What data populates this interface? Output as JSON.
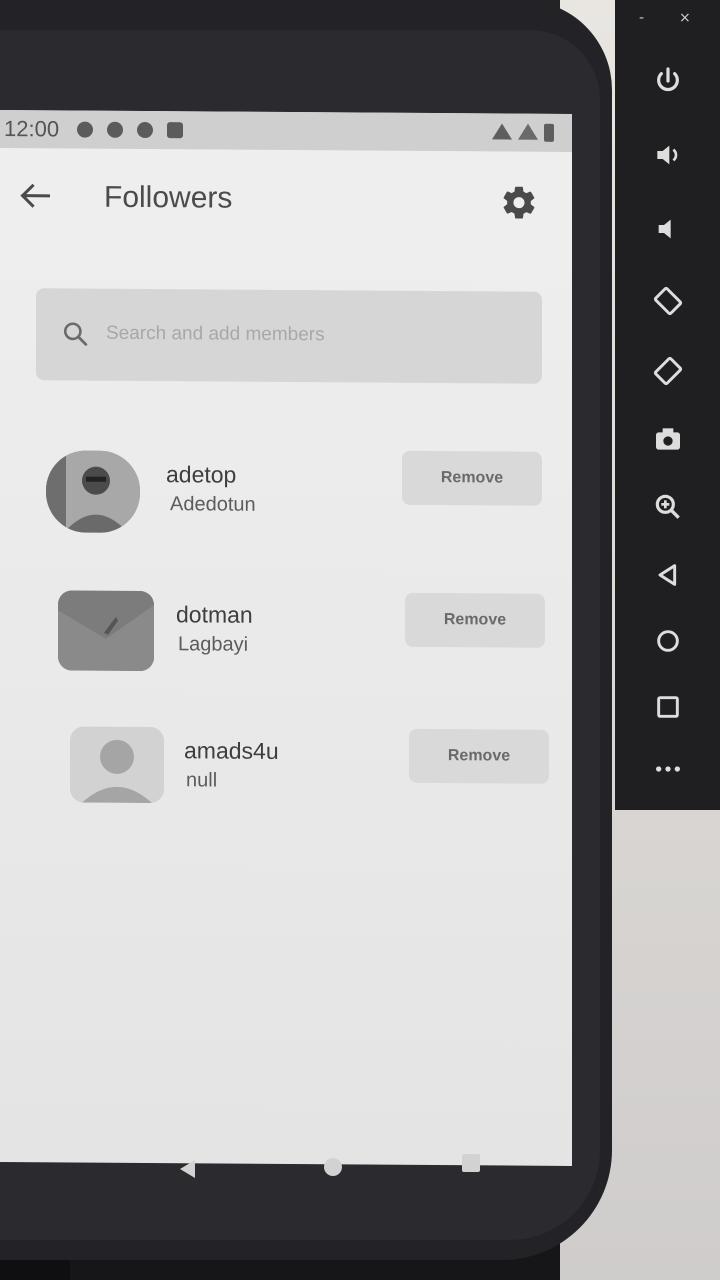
{
  "status_bar": {
    "time": "12:00"
  },
  "app_bar": {
    "title": "Followers"
  },
  "search": {
    "placeholder": "Search and add members"
  },
  "followers": [
    {
      "username": "adetop",
      "display_name": "Adedotun",
      "action": "Remove",
      "avatar": "photo"
    },
    {
      "username": "dotman",
      "display_name": "Lagbayi",
      "action": "Remove",
      "avatar": "photo"
    },
    {
      "username": "amads4u",
      "display_name": "null",
      "action": "Remove",
      "avatar": "person-placeholder"
    }
  ],
  "emulator_toolbar": {
    "window_buttons": [
      "-",
      "×"
    ],
    "buttons": [
      "power-icon",
      "volume-up-icon",
      "volume-down-icon",
      "rotate-left-icon",
      "rotate-right-icon",
      "camera-icon",
      "zoom-icon",
      "back-icon",
      "home-icon",
      "overview-icon",
      "more-icon"
    ]
  },
  "edge_text": [
    "×",
    "t",
    "00"
  ],
  "colors": {
    "screen_bg": "#efefef",
    "status_bg": "#cfcfcf",
    "search_bg": "#d6d6d6",
    "button_bg": "#d9d9d9",
    "text": "#3e3e3e"
  }
}
